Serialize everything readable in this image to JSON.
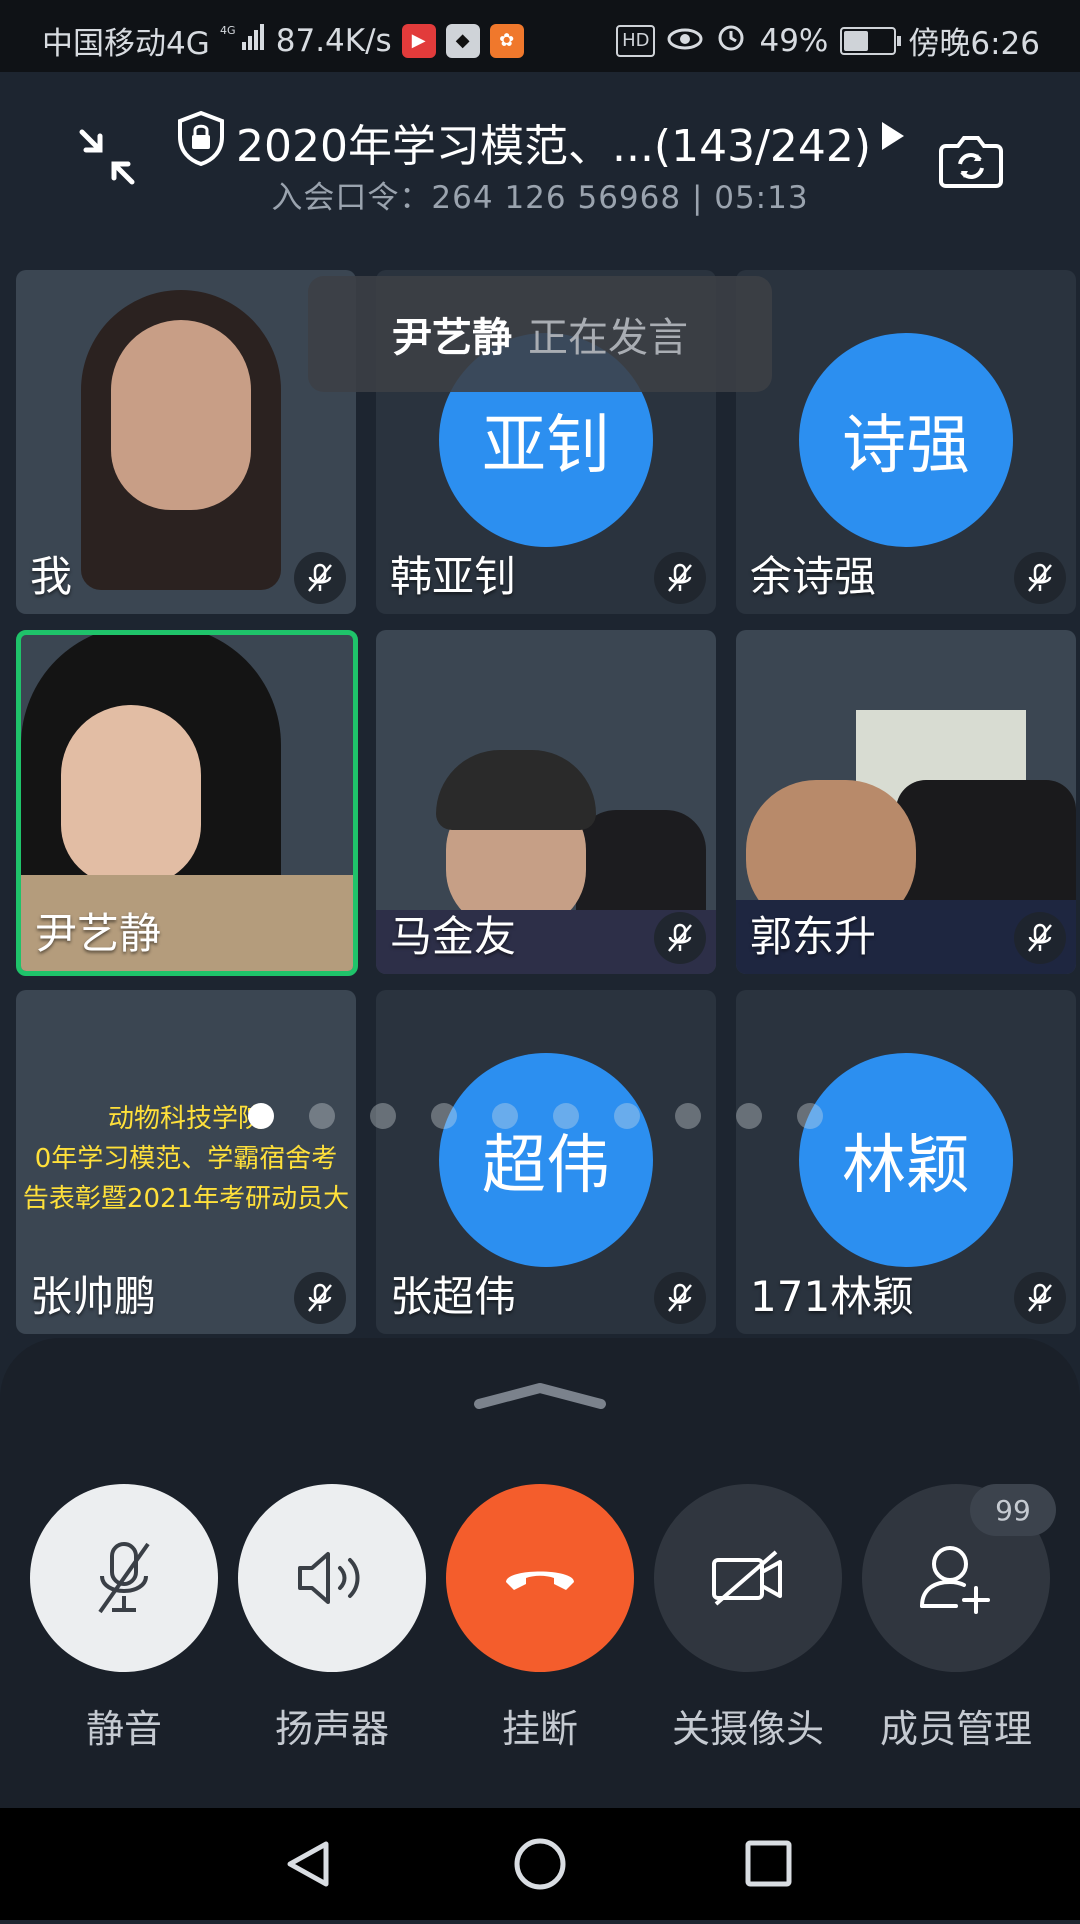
{
  "status_bar": {
    "carrier": "中国移动4G",
    "network": "4G",
    "speed": "87.4K/s",
    "hd": "HD",
    "battery": "49%",
    "battery_level": 0.49,
    "time": "傍晚6:26"
  },
  "header": {
    "title": "2020年学习模范、...(143/242)",
    "subtitle": "入会口令：264 126 56968 | 05:13"
  },
  "speaking": {
    "name": "尹艺静",
    "text": "正在发言"
  },
  "participants": [
    {
      "name": "我",
      "avatar": "",
      "muted": true
    },
    {
      "name": "韩亚钊",
      "avatar": "亚钊",
      "muted": true
    },
    {
      "name": "余诗强",
      "avatar": "诗强",
      "muted": true
    },
    {
      "name": "尹艺静",
      "avatar": "",
      "muted": false
    },
    {
      "name": "马金友",
      "avatar": "",
      "muted": true
    },
    {
      "name": "郭东升",
      "avatar": "",
      "muted": true
    },
    {
      "name": "张帅鹏",
      "avatar": "",
      "muted": true
    },
    {
      "name": "张超伟",
      "avatar": "超伟",
      "muted": true
    },
    {
      "name": "171林颖",
      "avatar": "林颖",
      "muted": true
    }
  ],
  "slide": {
    "line1": "动物科技学院",
    "line2": "0年学习模范、学霸宿舍考",
    "line3": "告表彰暨2021年考研动员大"
  },
  "pager": {
    "pages": 10,
    "current": 1
  },
  "controls": {
    "mute": "静音",
    "speaker": "扬声器",
    "hangup": "挂断",
    "camera_off": "关摄像头",
    "members": "成员管理",
    "members_badge": "99"
  },
  "colors": {
    "active_speaker": "#1fc36a",
    "avatar": "#2c8ff0",
    "hangup": "#f45d2c"
  }
}
